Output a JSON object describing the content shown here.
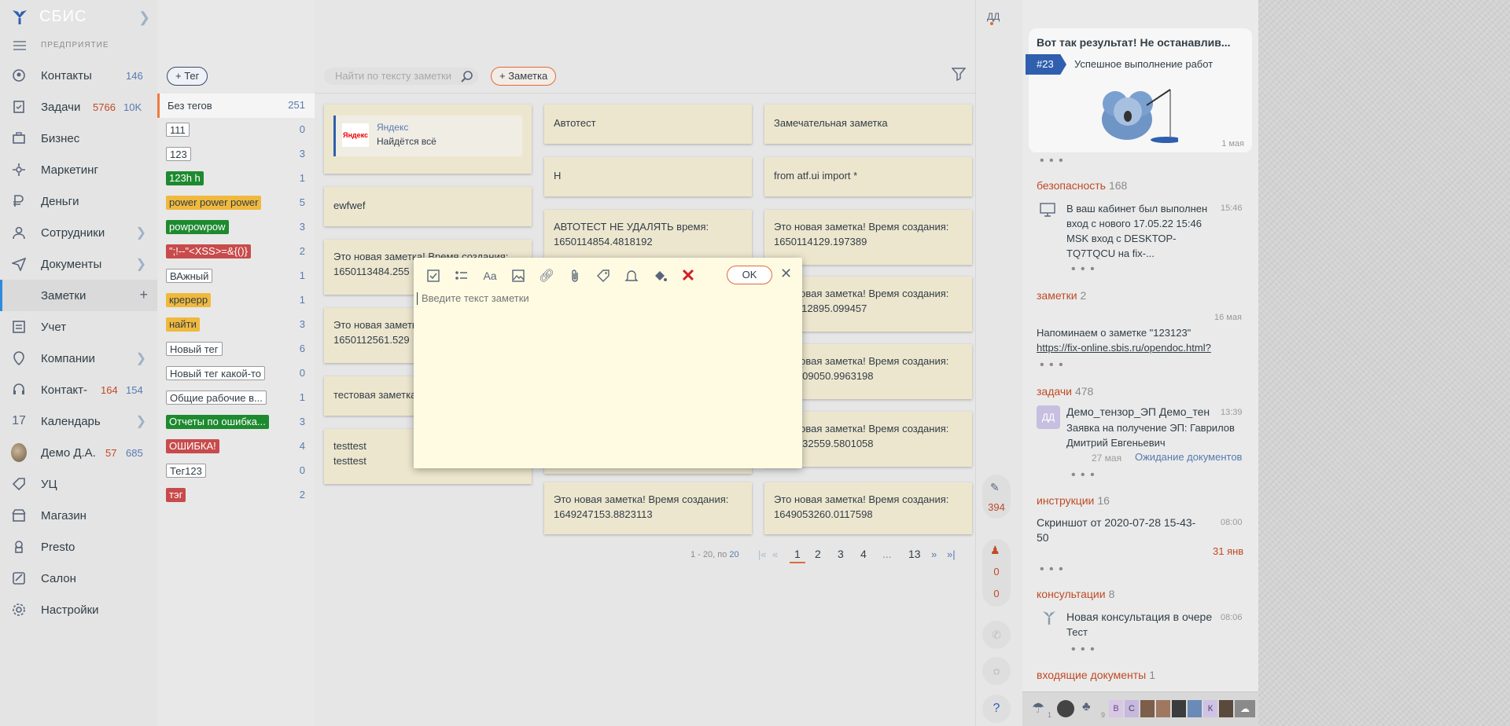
{
  "nav": {
    "brand": "СБИС",
    "section_label": "ПРЕДПРИЯТИЕ",
    "items": [
      {
        "label": "Контакты",
        "count1": "146",
        "count2": ""
      },
      {
        "label": "Задачи",
        "count1": "5766",
        "count2": "10K"
      },
      {
        "label": "Бизнес"
      },
      {
        "label": "Маркетинг"
      },
      {
        "label": "Деньги"
      },
      {
        "label": "Сотрудники"
      },
      {
        "label": "Документы"
      },
      {
        "label": "Заметки"
      },
      {
        "label": "Учет"
      },
      {
        "label": "Компании"
      },
      {
        "label": "Контакт-",
        "count1": "164",
        "count2": "154"
      },
      {
        "label": "Календарь",
        "icon_text": "17"
      },
      {
        "label": "Демо Д.А.",
        "count1": "57",
        "count2": "685"
      },
      {
        "label": "УЦ"
      },
      {
        "label": "Магазин"
      },
      {
        "label": "Presto"
      },
      {
        "label": "Салон"
      },
      {
        "label": "Настройки"
      }
    ],
    "add_symbol": "+"
  },
  "header": {
    "user_initials": "ДД"
  },
  "tags": {
    "add_button": "+ Тег",
    "list": [
      {
        "label": "Без тегов",
        "count": "251"
      },
      {
        "label": "111",
        "count": "0"
      },
      {
        "label": "123",
        "count": "3"
      },
      {
        "label": "123h h",
        "count": "1"
      },
      {
        "label": "power power power",
        "count": "5"
      },
      {
        "label": "powpowpow",
        "count": "3"
      },
      {
        "label": "\";!--\"<XSS>=&{()}",
        "count": "2"
      },
      {
        "label": "ВАжный",
        "count": "1"
      },
      {
        "label": "кререрр",
        "count": "1"
      },
      {
        "label": "найти",
        "count": "3"
      },
      {
        "label": "Новый тег",
        "count": "6"
      },
      {
        "label": "Новый тег какой-то",
        "count": "0"
      },
      {
        "label": "Общие рабочие в...",
        "count": "1"
      },
      {
        "label": "Отчеты по ошибка...",
        "count": "3"
      },
      {
        "label": "ОШИБКА!",
        "count": "4"
      },
      {
        "label": "Тег123",
        "count": "0"
      },
      {
        "label": "тэг",
        "count": "2"
      }
    ]
  },
  "toolbar": {
    "search_placeholder": "Найти по тексту заметки",
    "add_note": "+ Заметка"
  },
  "notes": {
    "yandex_title": "Яндекс",
    "yandex_logo": "Яндекс",
    "yandex_sub": "Найдётся всё",
    "n1": "ewfwef",
    "n2": "Это новая заметка! Время создания: 1650113484.255",
    "n3": "Это новая заметка! Время создания: 1650112561.529",
    "n4": "тестовая заметка",
    "n5a": "testtest",
    "n5b": "testtest",
    "n6": "Автотест",
    "n7": "Н",
    "n8": "АВТОТЕСТ НЕ УДАЛЯТЬ время: 1650114854.4818192",
    "n9": "Это новая заметка! Время создания: 1649247153.8823113",
    "n10": "Замечательная заметка",
    "n11": "from atf.ui import *",
    "n12": "Это новая заметка! Время создания: 1650114129.197389",
    "n13": "Это новая заметка! Время создания: 1650112895.099457",
    "n14": "Это новая заметка! Время создания: 1650109050.9963198",
    "n15": "Это новая заметка! Время создания: 1649832559.5801058",
    "n16": "Это новая заметка! Время создания: 1649053260.0117598"
  },
  "pager": {
    "range": "1 - 20, по",
    "page_size": "20",
    "pages": [
      "1",
      "2",
      "3",
      "4",
      "...",
      "13"
    ]
  },
  "side_widgets": {
    "c1": "394",
    "c2": "0",
    "c3": "0",
    "help": "?"
  },
  "dialog": {
    "ok": "OK",
    "placeholder": "Введите текст заметки"
  },
  "right": {
    "promo_title": "Вот так результат! Не останавлив...",
    "promo_badge": "#23",
    "promo_text": "Успешное выполнение работ",
    "promo_date": "1 мая",
    "sec_security": "безопасность",
    "sec_security_cnt": "168",
    "sec_security_text": "В ваш кабинет был выполнен вход с нового 17.05.22 15:46 MSK вход с DESKTOP-TQ7TQCU на fix-...",
    "sec_security_time": "15:46",
    "sec_notes": "заметки",
    "sec_notes_cnt": "2",
    "sec_notes_date": "16 мая",
    "sec_notes_text": "Напоминаем о заметке \"123123\"",
    "sec_notes_link": "https://fix-online.sbis.ru/opendoc.html?",
    "sec_tasks": "задачи",
    "sec_tasks_cnt": "478",
    "sec_tasks_avatar": "ДД",
    "sec_tasks_author": "Демо_тензор_ЭП Демо_тен",
    "sec_tasks_time": "13:39",
    "sec_tasks_text": "Заявка на получение ЭП: Гаврилов Дмитрий Евгеньевич",
    "sec_tasks_date": "27 мая",
    "sec_tasks_status": "Ожидание документов",
    "sec_instr": "инструкции",
    "sec_instr_cnt": "16",
    "sec_instr_text": "Скриншот от 2020-07-28 15-43-50",
    "sec_instr_time": "08:00",
    "sec_instr_date": "31 янв",
    "sec_consult": "консультации",
    "sec_consult_cnt": "8",
    "sec_consult_title": "Новая консультация в очере",
    "sec_consult_time": "08:06",
    "sec_consult_text": "Тест",
    "sec_incoming": "входящие документы",
    "sec_incoming_cnt": "1",
    "dock_counts": [
      "1",
      "9"
    ],
    "dock_letters": [
      "В",
      "С",
      "К"
    ]
  }
}
